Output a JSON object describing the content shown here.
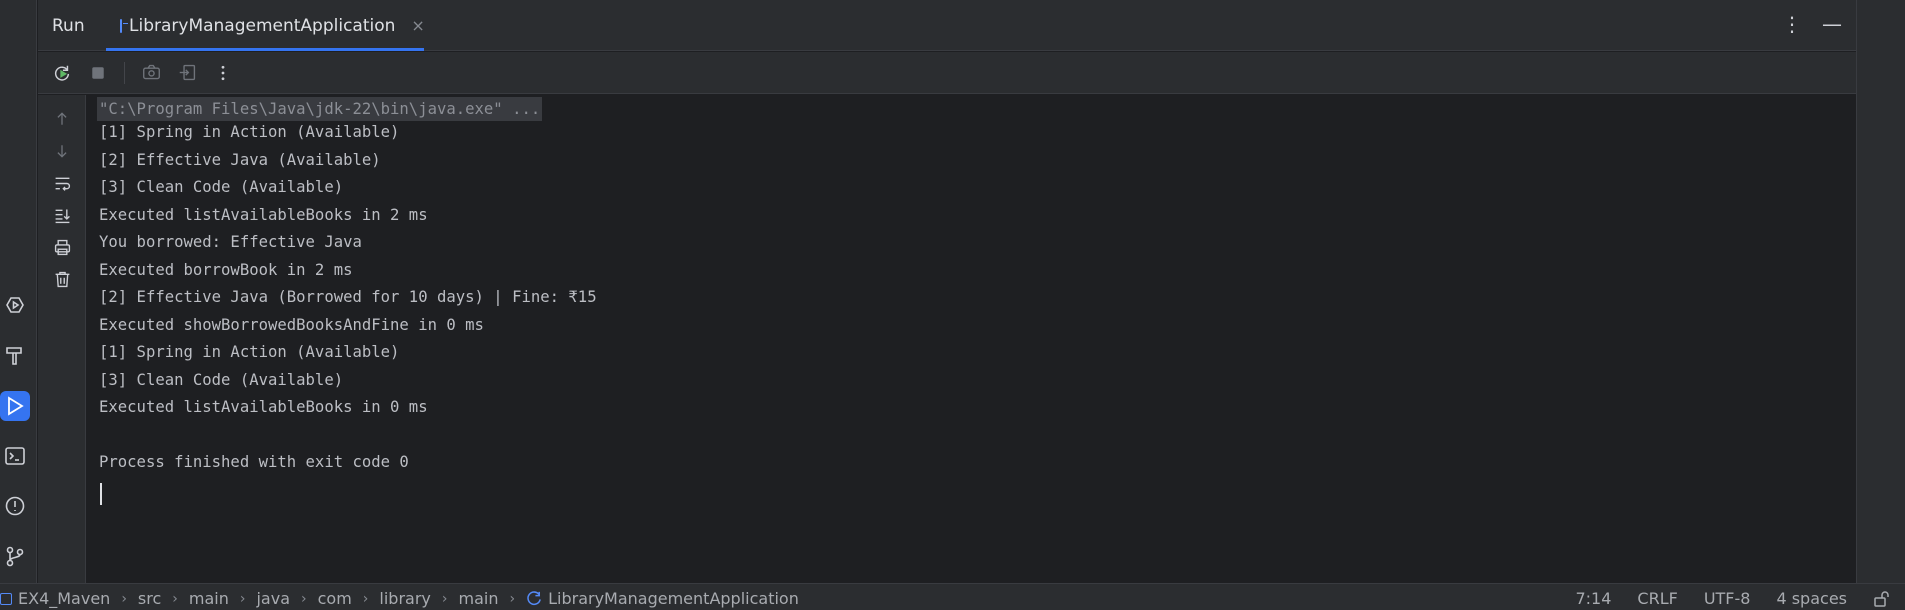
{
  "tool_window": {
    "title": "Run",
    "tab_label": "LibraryManagementApplication",
    "tab_close": "×",
    "more_options": "⋮",
    "minimize": "—"
  },
  "toolbar": {
    "icons": [
      "rerun-icon",
      "stop-icon",
      "camera-icon",
      "exit-icon",
      "more-icon"
    ]
  },
  "console_side": {
    "icons": [
      "arrow-up-icon",
      "arrow-down-icon",
      "soft-wrap-icon",
      "scroll-to-end-icon",
      "print-icon",
      "trash-icon"
    ]
  },
  "console": {
    "lines": [
      "\"C:\\Program Files\\Java\\jdk-22\\bin\\java.exe\" ...",
      "[1] Spring in Action (Available)",
      "[2] Effective Java (Available)",
      "[3] Clean Code (Available)",
      "Executed listAvailableBooks in 2 ms",
      "You borrowed: Effective Java",
      "Executed borrowBook in 2 ms",
      "[2] Effective Java (Borrowed for 10 days) | Fine: ₹15",
      "Executed showBorrowedBooksAndFine in 0 ms",
      "[1] Spring in Action (Available)",
      "[3] Clean Code (Available)",
      "Executed listAvailableBooks in 0 ms",
      "",
      "Process finished with exit code 0"
    ]
  },
  "left_strip": {
    "icons": [
      "services-icon",
      "build-icon",
      "run-icon",
      "terminal-icon",
      "problems-icon",
      "git-icon"
    ]
  },
  "statusbar": {
    "breadcrumbs": [
      "EX4_Maven",
      "src",
      "main",
      "java",
      "com",
      "library",
      "main",
      "LibraryManagementApplication"
    ],
    "position": "7:14",
    "line_separator": "CRLF",
    "encoding": "UTF-8",
    "indent": "4 spaces"
  },
  "colors": {
    "background": "#1e1f22",
    "panel": "#2b2d30",
    "accent": "#3574f0",
    "text": "#bcbec4"
  }
}
